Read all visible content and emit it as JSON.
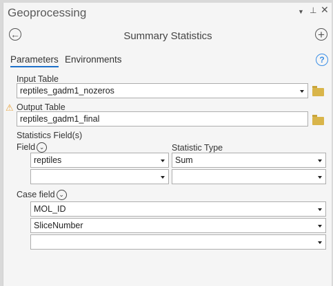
{
  "pane": {
    "title": "Geoprocessing"
  },
  "tool": {
    "title": "Summary Statistics"
  },
  "tabs": [
    {
      "label": "Parameters",
      "active": true
    },
    {
      "label": "Environments",
      "active": false
    }
  ],
  "params": {
    "input_table": {
      "label": "Input Table",
      "value": "reptiles_gadm1_nozeros"
    },
    "output_table": {
      "label": "Output Table",
      "value": "reptiles_gadm1_final",
      "warning": true
    },
    "statistics_fields": {
      "label": "Statistics Field(s)",
      "field_header": "Field",
      "type_header": "Statistic Type",
      "rows": [
        {
          "field": "reptiles",
          "type": "Sum"
        },
        {
          "field": "",
          "type": ""
        }
      ]
    },
    "case_field": {
      "label": "Case field",
      "rows": [
        "MOL_ID",
        "SliceNumber",
        ""
      ]
    }
  },
  "colors": {
    "accent": "#1a6fc9",
    "folder": "#d9b54a",
    "warning": "#e8a33d"
  }
}
